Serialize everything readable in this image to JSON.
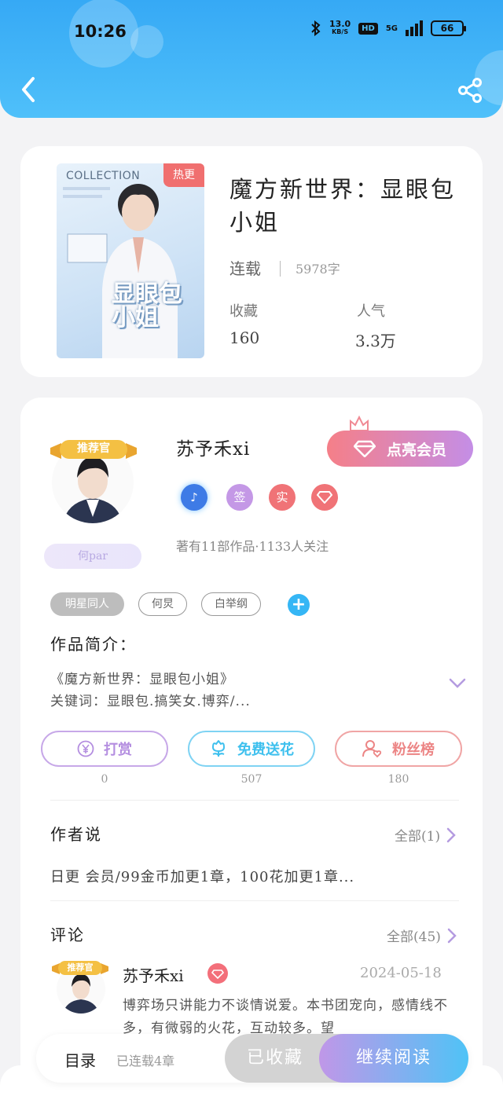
{
  "status_bar": {
    "time": "10:26",
    "net_speed_value": "13.0",
    "net_speed_unit": "KB/S",
    "hd": "HD",
    "network": "5G",
    "battery": "66"
  },
  "book": {
    "cover_collection": "COLLECTION",
    "cover_tag": "热更",
    "cover_title": "显眼包小姐",
    "title": "魔方新世界：显眼包小姐",
    "status": "连载",
    "word_count": "5978字",
    "favorites_label": "收藏",
    "favorites_value": "160",
    "popularity_label": "人气",
    "popularity_value": "3.3万"
  },
  "author": {
    "ribbon": "推荐官",
    "name": "苏予禾xi",
    "vip_button": "点亮会员",
    "badge_sign": "签",
    "badge_real": "实",
    "fan_badge": "何par",
    "meta": "著有11部作品·1133人关注",
    "tags": [
      "明星同人",
      "何炅",
      "白举纲"
    ],
    "add_tag": "+"
  },
  "intro": {
    "label": "作品简介：",
    "line1": "《魔方新世界：显眼包小姐》",
    "line2": "关键词：显眼包.搞笑女.博弈/..."
  },
  "actions": {
    "tip_label": "打赏",
    "tip_count": "0",
    "flower_label": "免费送花",
    "flower_count": "507",
    "fans_label": "粉丝榜",
    "fans_count": "180"
  },
  "author_says": {
    "label": "作者说",
    "more": "全部(1)",
    "text": "日更 会员/99金币加更1章，100花加更1章..."
  },
  "comments": {
    "label": "评论",
    "more": "全部(45)",
    "ribbon": "推荐官",
    "name": "苏予禾xi",
    "date": "2024-05-18",
    "text": "博弈场只讲能力不谈情说爱。本书团宠向，感情线不多，有微弱的火花，互动较多。望"
  },
  "bottom": {
    "toc": "目录",
    "toc_sub": "已连载4章",
    "collected": "已收藏",
    "read": "继续阅读"
  },
  "colors": {
    "header": "#36a9f5",
    "tip": "#b48ee0",
    "flower": "#3ec0ee",
    "fans": "#ec8585"
  }
}
